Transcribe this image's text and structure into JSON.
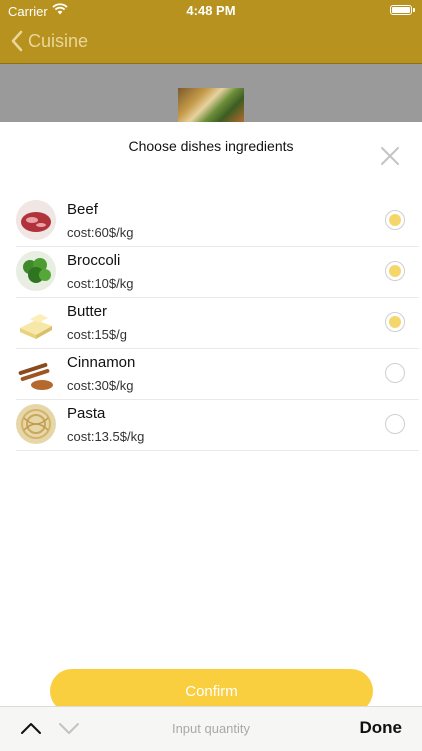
{
  "status_bar": {
    "carrier": "Carrier",
    "time": "4:48 PM"
  },
  "nav": {
    "back_label": "Cuisine"
  },
  "sheet": {
    "title": "Choose dishes ingredients",
    "ingredients": [
      {
        "name": "Beef",
        "cost": "cost:60$/kg",
        "selected": true,
        "icon": "beef-icon"
      },
      {
        "name": "Broccoli",
        "cost": "cost:10$/kg",
        "selected": true,
        "icon": "broccoli-icon"
      },
      {
        "name": "Butter",
        "cost": "cost:15$/g",
        "selected": true,
        "icon": "butter-icon"
      },
      {
        "name": "Cinnamon",
        "cost": "cost:30$/kg",
        "selected": false,
        "icon": "cinnamon-icon"
      },
      {
        "name": "Pasta",
        "cost": "cost:13.5$/kg",
        "selected": false,
        "icon": "pasta-icon"
      }
    ],
    "confirm_label": "Confirm"
  },
  "keyboard_toolbar": {
    "placeholder": "Input quantity",
    "done_label": "Done"
  },
  "colors": {
    "nav_bar": "#B8921E",
    "confirm": "#F9CF3F",
    "radio_selected": "#F5D66A"
  }
}
